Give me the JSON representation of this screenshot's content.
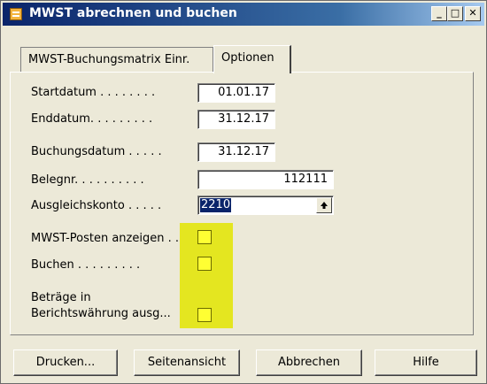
{
  "window": {
    "title": "MWST abrechnen und buchen",
    "controls": {
      "minimize": "_",
      "maximize": "□",
      "close": "✕"
    }
  },
  "tabs": [
    {
      "label": "MWST-Buchungsmatrix Einr.",
      "active": false
    },
    {
      "label": "Optionen",
      "active": true
    }
  ],
  "fields": {
    "startdatum": {
      "label": "Startdatum . . . . . . . .",
      "value": "01.01.17"
    },
    "enddatum": {
      "label": "Enddatum. . . . . . . . .",
      "value": "31.12.17"
    },
    "buchungsdatum": {
      "label": "Buchungsdatum . . . . .",
      "value": "31.12.17"
    },
    "belegnr": {
      "label": "Belegnr. . . . . . . . . .",
      "value": "112111"
    },
    "ausgleichskonto": {
      "label": "Ausgleichskonto . . . . .",
      "value": "2210",
      "lookup_icon": "up-arrow-icon"
    }
  },
  "options": {
    "mwst_posten": {
      "label": "MWST-Posten anzeigen . .",
      "checked": false
    },
    "buchen": {
      "label": "Buchen . . . . . . . . .",
      "checked": false
    },
    "betraege_line1": "Beträge in",
    "betraege_line2": "Berichtswährung ausg...",
    "betraege_checked": false
  },
  "buttons": {
    "drucken": "Drucken...",
    "seitenansicht": "Seitenansicht",
    "abbrechen": "Abbrechen",
    "hilfe": "Hilfe"
  },
  "colors": {
    "titlebar": "#0a246a",
    "highlight": "#e3e500",
    "checkbox": "#ffff33",
    "selection": "#0a246a"
  }
}
